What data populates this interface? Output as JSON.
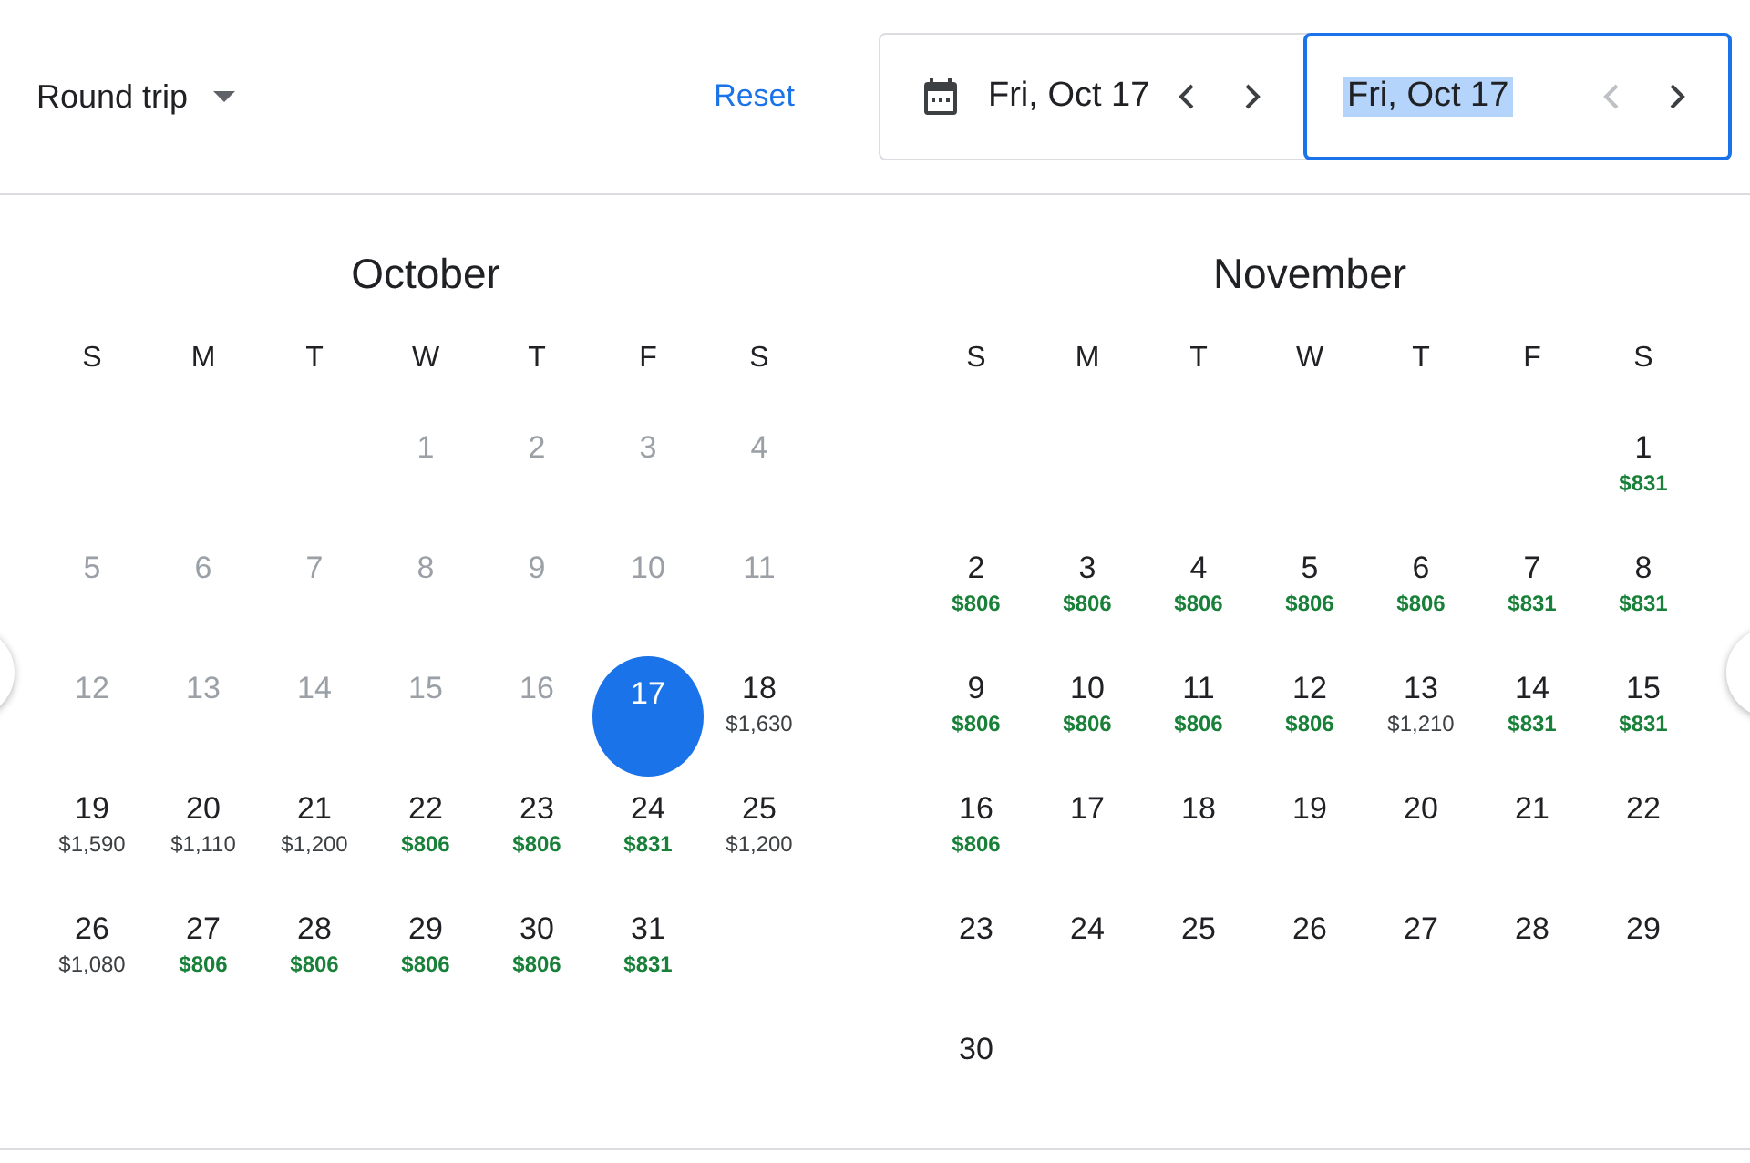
{
  "trip_type": {
    "label": "Round trip"
  },
  "reset": {
    "label": "Reset"
  },
  "departure": {
    "value": "Fri, Oct 17",
    "selected": false,
    "prev_disabled": false
  },
  "return": {
    "value": "Fri, Oct 17",
    "selected": true,
    "prev_disabled": true
  },
  "months": [
    {
      "title": "October",
      "weekdays": [
        "S",
        "M",
        "T",
        "W",
        "T",
        "F",
        "S"
      ],
      "weeks": [
        [
          {
            "day": "1",
            "disabled": true,
            "selected": false
          },
          {
            "day": "2",
            "disabled": true,
            "selected": false
          },
          {
            "day": "3",
            "disabled": true,
            "selected": false
          },
          {
            "day": "4",
            "disabled": true,
            "selected": false
          }
        ],
        [
          {
            "day": "5",
            "disabled": true,
            "selected": false
          },
          {
            "day": "6",
            "disabled": true,
            "selected": false
          },
          {
            "day": "7",
            "disabled": true,
            "selected": false
          },
          {
            "day": "8",
            "disabled": true,
            "selected": false
          },
          {
            "day": "9",
            "disabled": true,
            "selected": false
          },
          {
            "day": "10",
            "disabled": true,
            "selected": false
          },
          {
            "day": "11",
            "disabled": true,
            "selected": false
          }
        ],
        [
          {
            "day": "12",
            "disabled": true,
            "selected": false
          },
          {
            "day": "13",
            "disabled": true,
            "selected": false
          },
          {
            "day": "14",
            "disabled": true,
            "selected": false
          },
          {
            "day": "15",
            "disabled": true,
            "selected": false
          },
          {
            "day": "16",
            "disabled": true,
            "selected": false
          },
          {
            "day": "17",
            "disabled": false,
            "selected": true
          },
          {
            "day": "18",
            "price": "$1,630",
            "cheap": false,
            "disabled": false,
            "selected": false
          }
        ],
        [
          {
            "day": "19",
            "price": "$1,590",
            "cheap": false,
            "disabled": false,
            "selected": false
          },
          {
            "day": "20",
            "price": "$1,110",
            "cheap": false,
            "disabled": false,
            "selected": false
          },
          {
            "day": "21",
            "price": "$1,200",
            "cheap": false,
            "disabled": false,
            "selected": false
          },
          {
            "day": "22",
            "price": "$806",
            "cheap": true,
            "disabled": false,
            "selected": false
          },
          {
            "day": "23",
            "price": "$806",
            "cheap": true,
            "disabled": false,
            "selected": false
          },
          {
            "day": "24",
            "price": "$831",
            "cheap": true,
            "disabled": false,
            "selected": false
          },
          {
            "day": "25",
            "price": "$1,200",
            "cheap": false,
            "disabled": false,
            "selected": false
          }
        ],
        [
          {
            "day": "26",
            "price": "$1,080",
            "cheap": false,
            "disabled": false,
            "selected": false
          },
          {
            "day": "27",
            "price": "$806",
            "cheap": true,
            "disabled": false,
            "selected": false
          },
          {
            "day": "28",
            "price": "$806",
            "cheap": true,
            "disabled": false,
            "selected": false
          },
          {
            "day": "29",
            "price": "$806",
            "cheap": true,
            "disabled": false,
            "selected": false
          },
          {
            "day": "30",
            "price": "$806",
            "cheap": true,
            "disabled": false,
            "selected": false
          },
          {
            "day": "31",
            "price": "$831",
            "cheap": true,
            "disabled": false,
            "selected": false
          }
        ]
      ]
    },
    {
      "title": "November",
      "weekdays": [
        "S",
        "M",
        "T",
        "W",
        "T",
        "F",
        "S"
      ],
      "weeks": [
        [
          {
            "day": "1",
            "price": "$831",
            "cheap": true,
            "disabled": false,
            "selected": false
          }
        ],
        [
          {
            "day": "2",
            "price": "$806",
            "cheap": true,
            "disabled": false,
            "selected": false
          },
          {
            "day": "3",
            "price": "$806",
            "cheap": true,
            "disabled": false,
            "selected": false
          },
          {
            "day": "4",
            "price": "$806",
            "cheap": true,
            "disabled": false,
            "selected": false
          },
          {
            "day": "5",
            "price": "$806",
            "cheap": true,
            "disabled": false,
            "selected": false
          },
          {
            "day": "6",
            "price": "$806",
            "cheap": true,
            "disabled": false,
            "selected": false
          },
          {
            "day": "7",
            "price": "$831",
            "cheap": true,
            "disabled": false,
            "selected": false
          },
          {
            "day": "8",
            "price": "$831",
            "cheap": true,
            "disabled": false,
            "selected": false
          }
        ],
        [
          {
            "day": "9",
            "price": "$806",
            "cheap": true,
            "disabled": false,
            "selected": false
          },
          {
            "day": "10",
            "price": "$806",
            "cheap": true,
            "disabled": false,
            "selected": false
          },
          {
            "day": "11",
            "price": "$806",
            "cheap": true,
            "disabled": false,
            "selected": false
          },
          {
            "day": "12",
            "price": "$806",
            "cheap": true,
            "disabled": false,
            "selected": false
          },
          {
            "day": "13",
            "price": "$1,210",
            "cheap": false,
            "disabled": false,
            "selected": false
          },
          {
            "day": "14",
            "price": "$831",
            "cheap": true,
            "disabled": false,
            "selected": false
          },
          {
            "day": "15",
            "price": "$831",
            "cheap": true,
            "disabled": false,
            "selected": false
          }
        ],
        [
          {
            "day": "16",
            "price": "$806",
            "cheap": true,
            "disabled": false,
            "selected": false
          },
          {
            "day": "17",
            "disabled": false,
            "selected": false
          },
          {
            "day": "18",
            "disabled": false,
            "selected": false
          },
          {
            "day": "19",
            "disabled": false,
            "selected": false
          },
          {
            "day": "20",
            "disabled": false,
            "selected": false
          },
          {
            "day": "21",
            "disabled": false,
            "selected": false
          },
          {
            "day": "22",
            "disabled": false,
            "selected": false
          }
        ],
        [
          {
            "day": "23",
            "disabled": false,
            "selected": false
          },
          {
            "day": "24",
            "disabled": false,
            "selected": false
          },
          {
            "day": "25",
            "disabled": false,
            "selected": false
          },
          {
            "day": "26",
            "disabled": false,
            "selected": false
          },
          {
            "day": "27",
            "disabled": false,
            "selected": false
          },
          {
            "day": "28",
            "disabled": false,
            "selected": false
          },
          {
            "day": "29",
            "disabled": false,
            "selected": false
          }
        ],
        [
          {
            "day": "30",
            "disabled": false,
            "selected": false
          }
        ]
      ]
    }
  ]
}
